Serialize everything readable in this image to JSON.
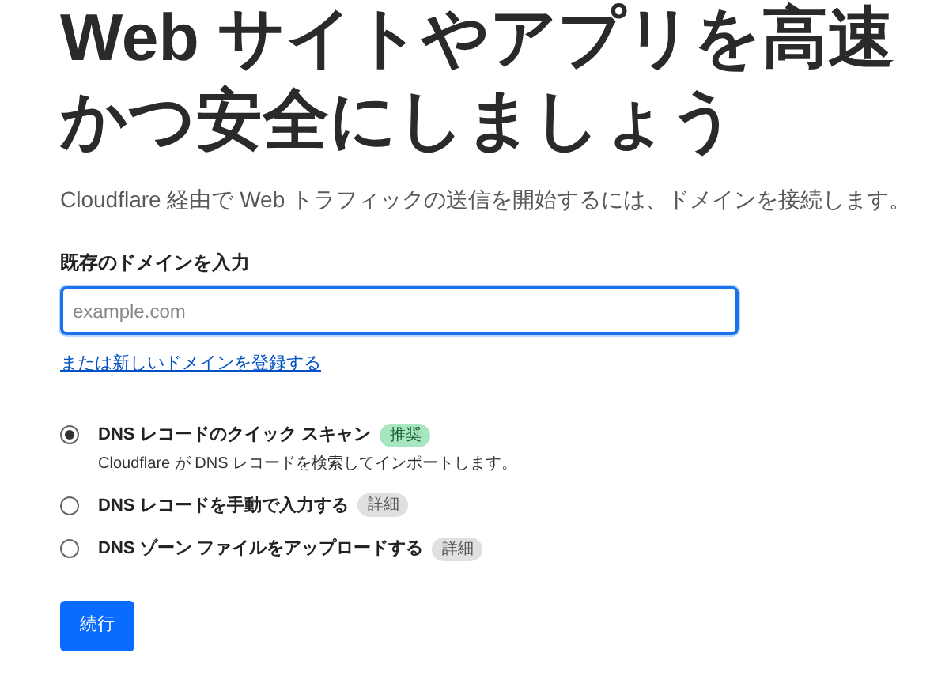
{
  "heading": "Web サイトやアプリを高速かつ安全にしましょう",
  "subtitle": "Cloudflare 経由で Web トラフィックの送信を開始するには、ドメインを接続します。",
  "domain_field": {
    "label": "既存のドメインを入力",
    "placeholder": "example.com",
    "focused": true
  },
  "register_link": "または新しいドメインを登録する",
  "options": [
    {
      "label": "DNS レコードのクイック スキャン",
      "badge": {
        "text": "推奨",
        "kind": "recommended"
      },
      "description": "Cloudflare が DNS レコードを検索してインポートします。",
      "selected": true
    },
    {
      "label": "DNS レコードを手動で入力する",
      "badge": {
        "text": "詳細",
        "kind": "details"
      },
      "selected": false
    },
    {
      "label": "DNS ゾーン ファイルをアップロードする",
      "badge": {
        "text": "詳細",
        "kind": "details"
      },
      "selected": false
    }
  ],
  "continue_button": "続行"
}
